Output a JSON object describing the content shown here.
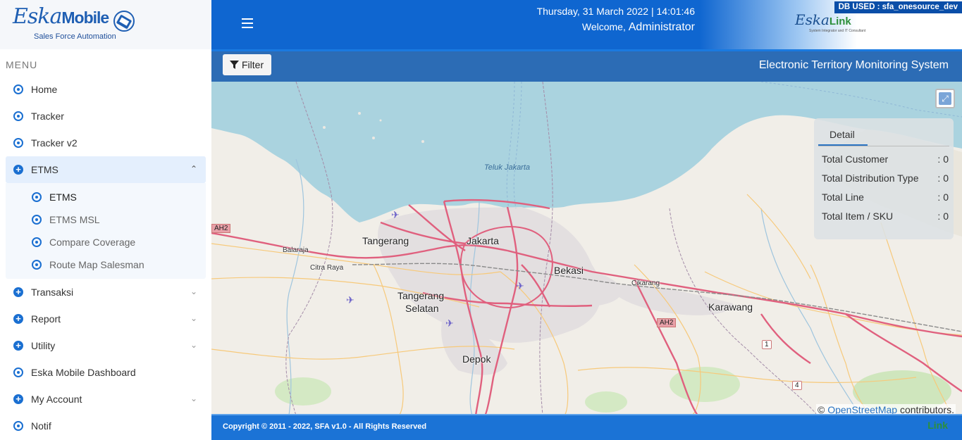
{
  "brand": {
    "logo_script": "Eska",
    "logo_bold": "Mobile",
    "tagline": "Sales Force Automation"
  },
  "sidebar": {
    "menu_title": "MENU",
    "items": [
      {
        "label": "Home"
      },
      {
        "label": "Tracker"
      },
      {
        "label": "Tracker v2"
      },
      {
        "label": "ETMS",
        "expanded": true
      },
      {
        "label": "Transaksi"
      },
      {
        "label": "Report"
      },
      {
        "label": "Utility"
      },
      {
        "label": "Eska Mobile Dashboard"
      },
      {
        "label": "My Account"
      },
      {
        "label": "Notif"
      }
    ],
    "etms_sub": [
      {
        "label": "ETMS"
      },
      {
        "label": "ETMS MSL"
      },
      {
        "label": "Compare Coverage"
      },
      {
        "label": "Route Map Salesman"
      }
    ]
  },
  "header": {
    "datetime": "Thursday, 31 March 2022 | 14:01:46",
    "welcome": "Welcome,",
    "user": "Administrator",
    "partner_logo_script": "Eska",
    "partner_logo_bold": "Link",
    "partner_tagline": "System Integrator and IT Consultant",
    "db_badge": "DB USED : sfa_onesource_dev"
  },
  "toolbar": {
    "filter_label": "Filter",
    "system_title": "Electronic Territory Monitoring System"
  },
  "map": {
    "places": {
      "jakarta": "Jakarta",
      "tangerang": "Tangerang",
      "tangerang_selatan_1": "Tangerang",
      "tangerang_selatan_2": "Selatan",
      "bekasi": "Bekasi",
      "karawang": "Karawang",
      "depok": "Depok",
      "cikarang": "Cikarang",
      "balaraja": "Balaraja",
      "citra_raya": "Citra Raya",
      "teluk_jakarta": "Teluk Jakarta"
    },
    "shields": {
      "ah2_left": "AH2",
      "ah2_right": "AH2",
      "route1": "1",
      "route4": "4"
    },
    "attribution_prefix": "©",
    "attribution_link": "OpenStreetMap",
    "attribution_suffix": "contributors."
  },
  "detail": {
    "tab_label": "Detail",
    "rows": [
      {
        "label": "Total Customer",
        "value": ": 0"
      },
      {
        "label": "Total Distribution Type",
        "value": ": 0"
      },
      {
        "label": "Total Line",
        "value": ": 0"
      },
      {
        "label": "Total Item / SKU",
        "value": ": 0"
      }
    ]
  },
  "footer": {
    "copyright": "Copyright © 2011 - 2022, SFA v1.0 - All Rights Reserved",
    "logo_text": "Link"
  },
  "colors": {
    "primary": "#0f66d0",
    "toolbar": "#2c6cb5",
    "sea": "#aad3df",
    "road": "#e0607e"
  }
}
